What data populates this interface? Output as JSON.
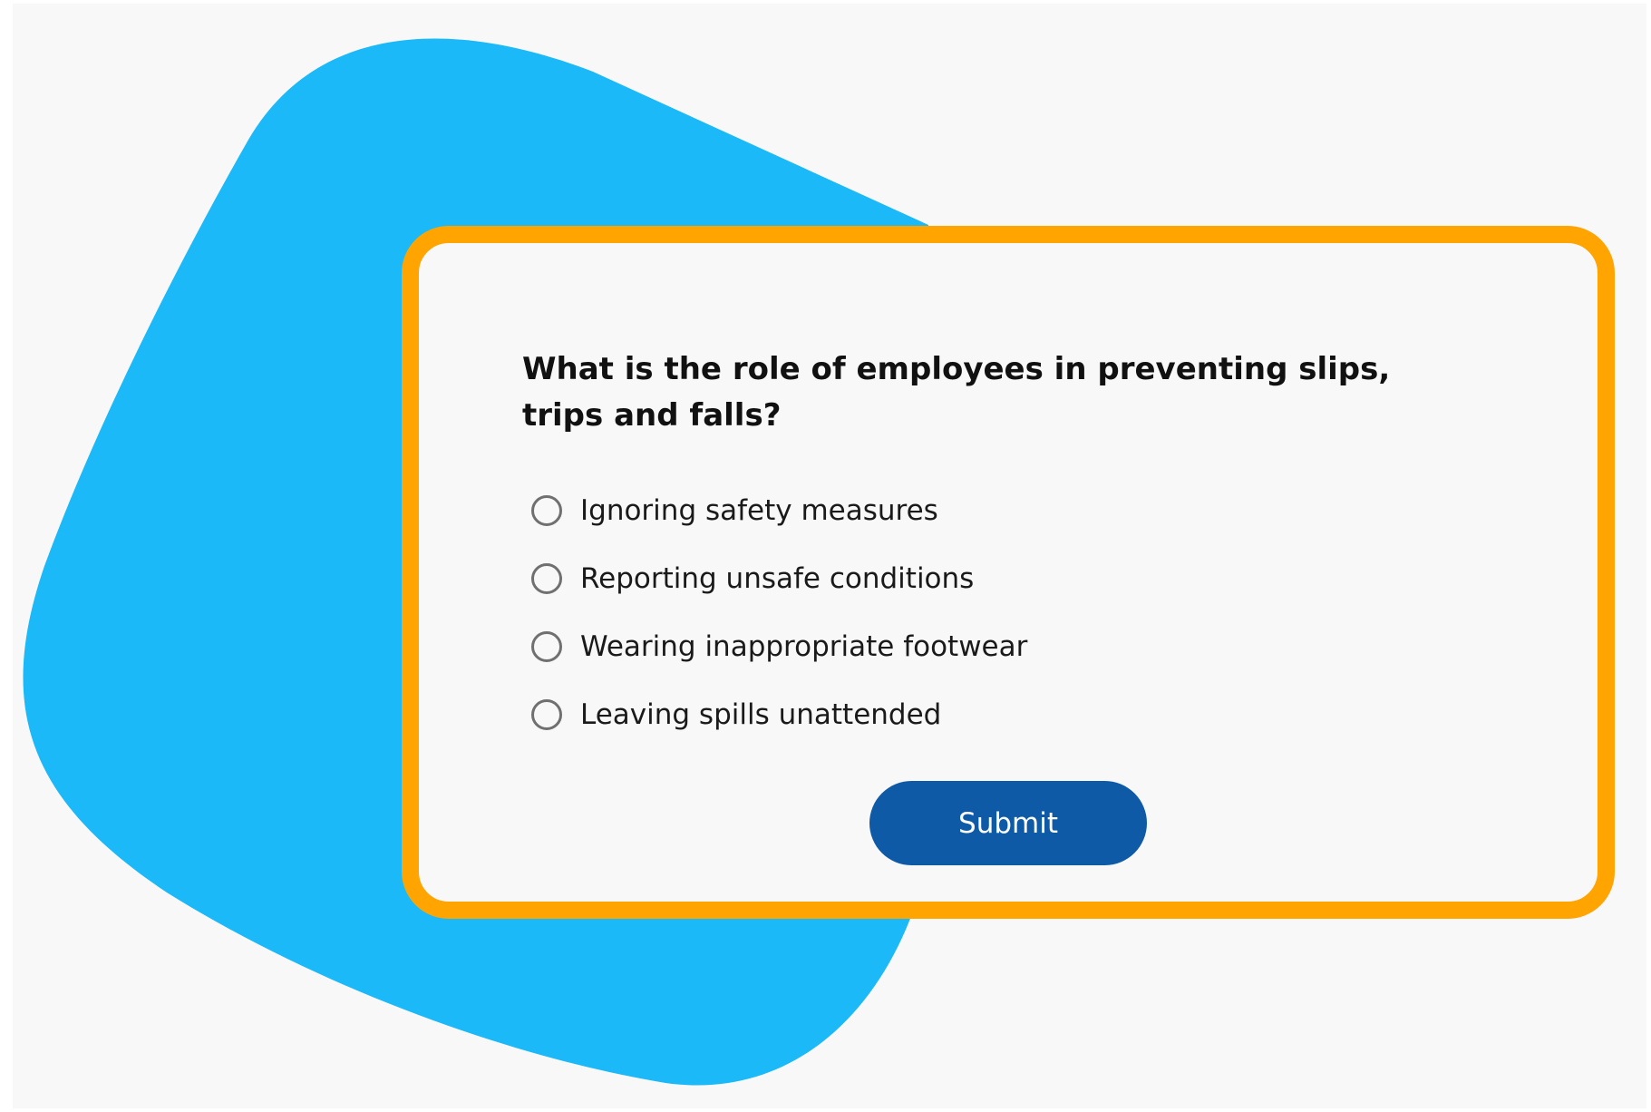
{
  "quiz": {
    "question": "What is the role of employees in preventing slips, trips and falls?",
    "options": [
      {
        "label": "Ignoring safety measures",
        "selected": false
      },
      {
        "label": "Reporting unsafe conditions",
        "selected": false
      },
      {
        "label": "Wearing inappropriate footwear",
        "selected": false
      },
      {
        "label": "Leaving spills unattended",
        "selected": false
      }
    ],
    "submit_label": "Submit"
  },
  "colors": {
    "background": "#f8f8f8",
    "blob": "#1bb9f7",
    "card_border": "#ffa400",
    "button": "#0e5aa7",
    "button_text": "#ffffff",
    "radio_border": "#707070"
  }
}
